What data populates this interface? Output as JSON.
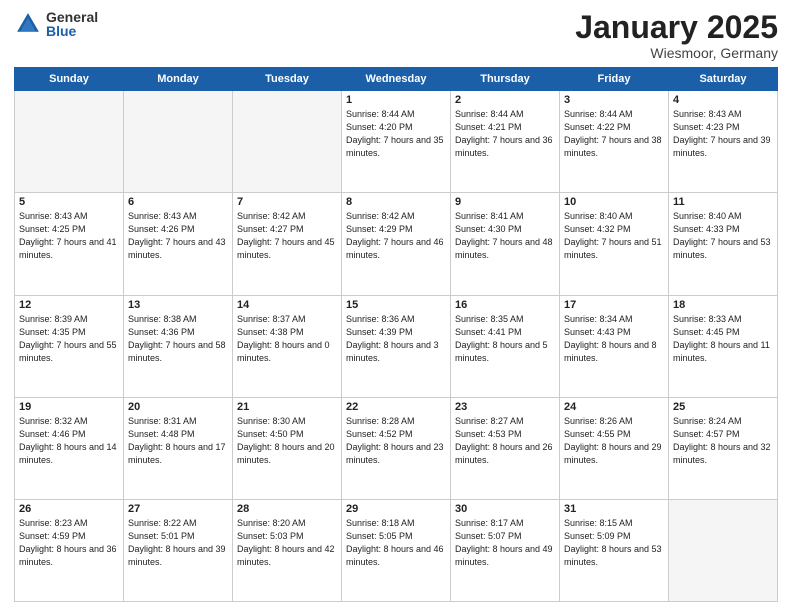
{
  "header": {
    "logo_general": "General",
    "logo_blue": "Blue",
    "month_title": "January 2025",
    "location": "Wiesmoor, Germany"
  },
  "days_of_week": [
    "Sunday",
    "Monday",
    "Tuesday",
    "Wednesday",
    "Thursday",
    "Friday",
    "Saturday"
  ],
  "weeks": [
    [
      {
        "num": "",
        "empty": true
      },
      {
        "num": "",
        "empty": true
      },
      {
        "num": "",
        "empty": true
      },
      {
        "num": "1",
        "sunrise": "8:44 AM",
        "sunset": "4:20 PM",
        "daylight": "7 hours and 35 minutes."
      },
      {
        "num": "2",
        "sunrise": "8:44 AM",
        "sunset": "4:21 PM",
        "daylight": "7 hours and 36 minutes."
      },
      {
        "num": "3",
        "sunrise": "8:44 AM",
        "sunset": "4:22 PM",
        "daylight": "7 hours and 38 minutes."
      },
      {
        "num": "4",
        "sunrise": "8:43 AM",
        "sunset": "4:23 PM",
        "daylight": "7 hours and 39 minutes."
      }
    ],
    [
      {
        "num": "5",
        "sunrise": "8:43 AM",
        "sunset": "4:25 PM",
        "daylight": "7 hours and 41 minutes."
      },
      {
        "num": "6",
        "sunrise": "8:43 AM",
        "sunset": "4:26 PM",
        "daylight": "7 hours and 43 minutes."
      },
      {
        "num": "7",
        "sunrise": "8:42 AM",
        "sunset": "4:27 PM",
        "daylight": "7 hours and 45 minutes."
      },
      {
        "num": "8",
        "sunrise": "8:42 AM",
        "sunset": "4:29 PM",
        "daylight": "7 hours and 46 minutes."
      },
      {
        "num": "9",
        "sunrise": "8:41 AM",
        "sunset": "4:30 PM",
        "daylight": "7 hours and 48 minutes."
      },
      {
        "num": "10",
        "sunrise": "8:40 AM",
        "sunset": "4:32 PM",
        "daylight": "7 hours and 51 minutes."
      },
      {
        "num": "11",
        "sunrise": "8:40 AM",
        "sunset": "4:33 PM",
        "daylight": "7 hours and 53 minutes."
      }
    ],
    [
      {
        "num": "12",
        "sunrise": "8:39 AM",
        "sunset": "4:35 PM",
        "daylight": "7 hours and 55 minutes."
      },
      {
        "num": "13",
        "sunrise": "8:38 AM",
        "sunset": "4:36 PM",
        "daylight": "7 hours and 58 minutes."
      },
      {
        "num": "14",
        "sunrise": "8:37 AM",
        "sunset": "4:38 PM",
        "daylight": "8 hours and 0 minutes."
      },
      {
        "num": "15",
        "sunrise": "8:36 AM",
        "sunset": "4:39 PM",
        "daylight": "8 hours and 3 minutes."
      },
      {
        "num": "16",
        "sunrise": "8:35 AM",
        "sunset": "4:41 PM",
        "daylight": "8 hours and 5 minutes."
      },
      {
        "num": "17",
        "sunrise": "8:34 AM",
        "sunset": "4:43 PM",
        "daylight": "8 hours and 8 minutes."
      },
      {
        "num": "18",
        "sunrise": "8:33 AM",
        "sunset": "4:45 PM",
        "daylight": "8 hours and 11 minutes."
      }
    ],
    [
      {
        "num": "19",
        "sunrise": "8:32 AM",
        "sunset": "4:46 PM",
        "daylight": "8 hours and 14 minutes."
      },
      {
        "num": "20",
        "sunrise": "8:31 AM",
        "sunset": "4:48 PM",
        "daylight": "8 hours and 17 minutes."
      },
      {
        "num": "21",
        "sunrise": "8:30 AM",
        "sunset": "4:50 PM",
        "daylight": "8 hours and 20 minutes."
      },
      {
        "num": "22",
        "sunrise": "8:28 AM",
        "sunset": "4:52 PM",
        "daylight": "8 hours and 23 minutes."
      },
      {
        "num": "23",
        "sunrise": "8:27 AM",
        "sunset": "4:53 PM",
        "daylight": "8 hours and 26 minutes."
      },
      {
        "num": "24",
        "sunrise": "8:26 AM",
        "sunset": "4:55 PM",
        "daylight": "8 hours and 29 minutes."
      },
      {
        "num": "25",
        "sunrise": "8:24 AM",
        "sunset": "4:57 PM",
        "daylight": "8 hours and 32 minutes."
      }
    ],
    [
      {
        "num": "26",
        "sunrise": "8:23 AM",
        "sunset": "4:59 PM",
        "daylight": "8 hours and 36 minutes."
      },
      {
        "num": "27",
        "sunrise": "8:22 AM",
        "sunset": "5:01 PM",
        "daylight": "8 hours and 39 minutes."
      },
      {
        "num": "28",
        "sunrise": "8:20 AM",
        "sunset": "5:03 PM",
        "daylight": "8 hours and 42 minutes."
      },
      {
        "num": "29",
        "sunrise": "8:18 AM",
        "sunset": "5:05 PM",
        "daylight": "8 hours and 46 minutes."
      },
      {
        "num": "30",
        "sunrise": "8:17 AM",
        "sunset": "5:07 PM",
        "daylight": "8 hours and 49 minutes."
      },
      {
        "num": "31",
        "sunrise": "8:15 AM",
        "sunset": "5:09 PM",
        "daylight": "8 hours and 53 minutes."
      },
      {
        "num": "",
        "empty": true
      }
    ]
  ]
}
